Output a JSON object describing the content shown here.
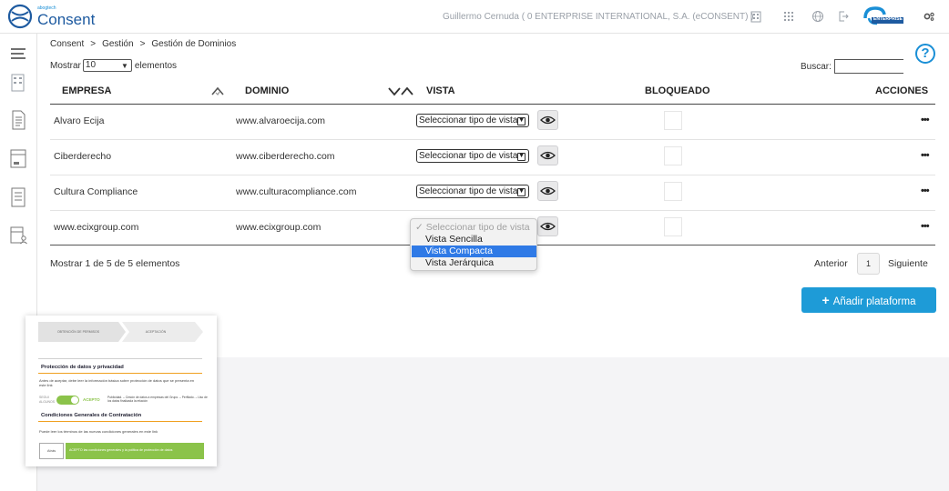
{
  "header": {
    "brand_small": "abogtech",
    "brand": "Consent",
    "user": "Guillermo Cernuda ( 0 ENTERPRISE INTERNATIONAL, S.A. (eCONSENT) )",
    "enterprise_logo_text": "ENTERPRISE",
    "accent_color": "#1a8fd6"
  },
  "breadcrumb": {
    "items": [
      "Consent",
      "Gestión",
      "Gestión de Dominios"
    ],
    "separator": ">"
  },
  "controls": {
    "show_prefix": "Mostrar",
    "page_size": "10",
    "show_suffix": "elementos",
    "search_label": "Buscar:",
    "search_value": ""
  },
  "table": {
    "columns": [
      "EMPRESA",
      "DOMINIO",
      "VISTA",
      "BLOQUEADO",
      "ACCIONES"
    ],
    "rows": [
      {
        "empresa": "Alvaro Ecija",
        "dominio": "www.alvaroecija.com",
        "vista": "Seleccionar tipo de vista",
        "acciones": "•••"
      },
      {
        "empresa": "Ciberderecho",
        "dominio": "www.ciberderecho.com",
        "vista": "Seleccionar tipo de vista",
        "acciones": "•••"
      },
      {
        "empresa": "Cultura Compliance",
        "dominio": "www.culturacompliance.com",
        "vista": "Seleccionar tipo de vista",
        "acciones": "•••"
      },
      {
        "empresa": "www.ecixgroup.com",
        "dominio": "www.ecixgroup.com",
        "vista": "Seleccionar tipo de vista",
        "acciones": "•••"
      }
    ]
  },
  "dropdown": {
    "placeholder": "✓ Seleccionar tipo de vista",
    "options": [
      "Vista Sencilla",
      "Vista Compacta",
      "Vista Jerárquica"
    ],
    "highlighted": "Vista Compacta"
  },
  "footer": {
    "info": "Mostrar 1 de 5 de 5 elementos",
    "prev": "Anterior",
    "page": "1",
    "next": "Siguiente",
    "add_button": "Añadir plataforma",
    "add_button_color": "#1e9bd7"
  },
  "preview": {
    "step1": "OBTENCIÓN DE PERMISOS",
    "step2": "ACEPTACIÓN",
    "section1_title": "Protección de datos y privacidad",
    "section1_text": "Antes de aceptar, debe leer la información básica sobre protección de datos que se presenta en este link",
    "toggle_left": "SEGUI ALGUNOS",
    "toggle_right": "ACEPTO",
    "toggle_desc": "Publicidad. – Cesión de datos a empresas del Grupo. – Perfilado. – Uso de los datos finalizada la relación",
    "section2_title": "Condiciones Generales de Contratación",
    "section2_text": "Puede leer los términos de las nuevas condiciones generales en este link",
    "btn_back": "Atrás",
    "btn_accept": "ACEPTO las condiciones generales y la política de protección de datos",
    "orange": "#f0a020",
    "green": "#8bc34a"
  }
}
